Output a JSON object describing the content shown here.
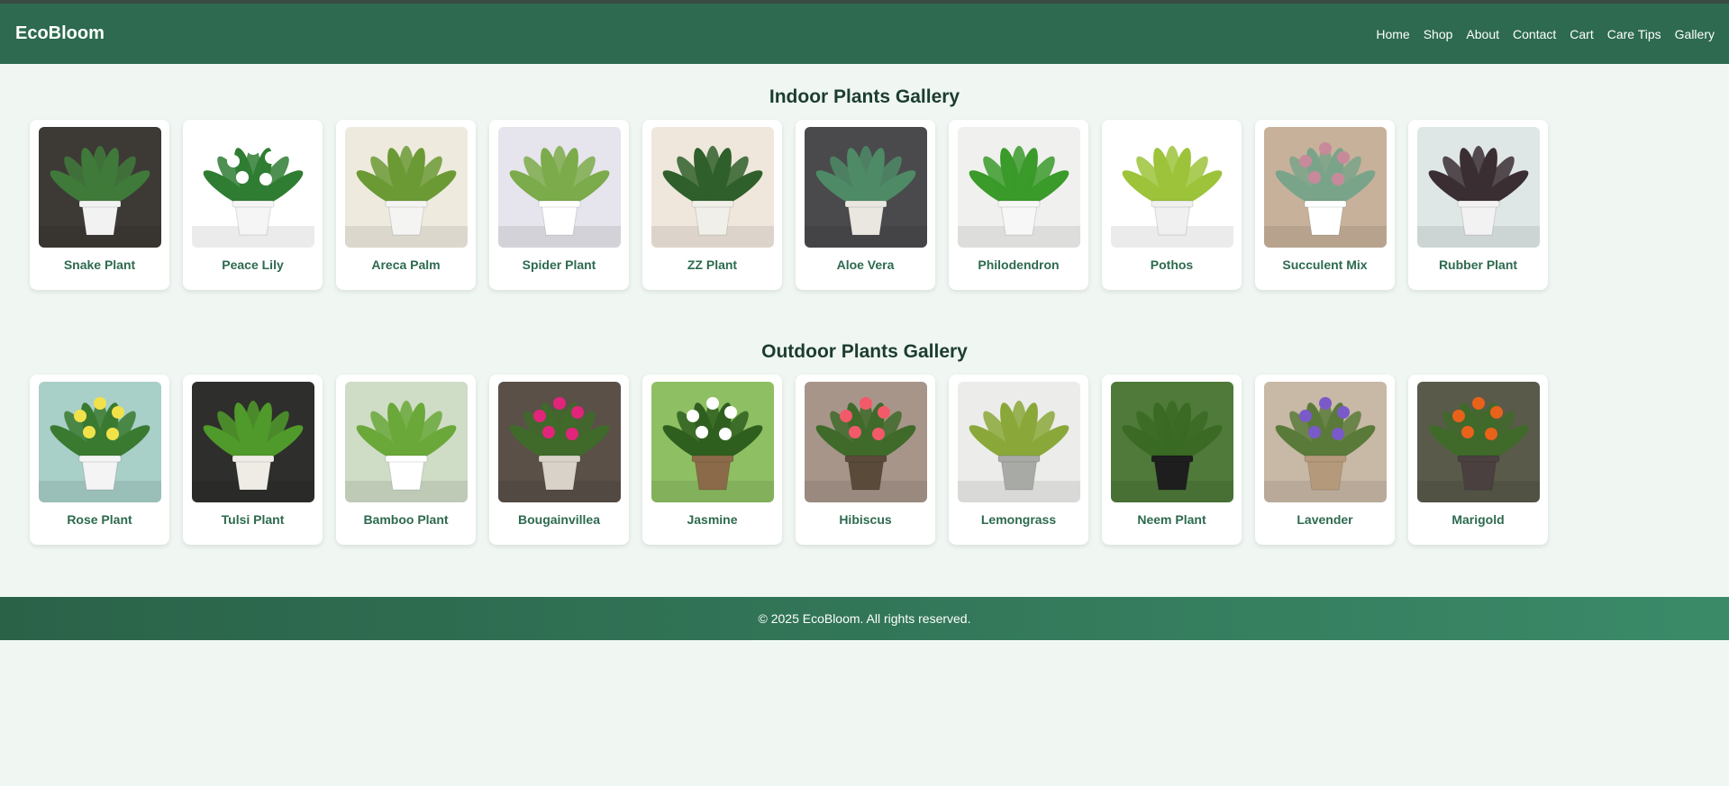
{
  "brand": "EcoBloom",
  "nav": [
    "Home",
    "Shop",
    "About",
    "Contact",
    "Cart",
    "Care Tips",
    "Gallery"
  ],
  "indoor": {
    "title": "Indoor Plants Gallery",
    "plants": [
      {
        "name": "Snake Plant",
        "bg": "#3d3a36",
        "pot": "#f2f2f2",
        "leaf": "#3f7a3a",
        "flower": ""
      },
      {
        "name": "Peace Lily",
        "bg": "#ffffff",
        "pot": "#f5f5f5",
        "leaf": "#2f7d32",
        "flower": "#ffffff"
      },
      {
        "name": "Areca Palm",
        "bg": "#eeeade",
        "pot": "#f4f4f2",
        "leaf": "#6b9a35",
        "flower": ""
      },
      {
        "name": "Spider Plant",
        "bg": "#e6e4ec",
        "pot": "#ffffff",
        "leaf": "#7bab4a",
        "flower": ""
      },
      {
        "name": "ZZ Plant",
        "bg": "#efe7dc",
        "pot": "#f1efe9",
        "leaf": "#2f5f2a",
        "flower": ""
      },
      {
        "name": "Aloe Vera",
        "bg": "#4a4a4c",
        "pot": "#e9e7e0",
        "leaf": "#4e8a66",
        "flower": ""
      },
      {
        "name": "Philodendron",
        "bg": "#f0f0ee",
        "pot": "#f7f7f7",
        "leaf": "#3a9a2a",
        "flower": ""
      },
      {
        "name": "Pothos",
        "bg": "#ffffff",
        "pot": "#f0f0f0",
        "leaf": "#9cc33a",
        "flower": ""
      },
      {
        "name": "Succulent Mix",
        "bg": "#c7b19a",
        "pot": "#ffffff",
        "leaf": "#7aa48a",
        "flower": "#c78a9a"
      },
      {
        "name": "Rubber Plant",
        "bg": "#dfe7e6",
        "pot": "#f2f2f2",
        "leaf": "#3a2e33",
        "flower": ""
      }
    ]
  },
  "outdoor": {
    "title": "Outdoor Plants Gallery",
    "plants": [
      {
        "name": "Rose Plant",
        "bg": "#a8cfc8",
        "pot": "#f4f4f4",
        "leaf": "#3a7a30",
        "flower": "#f2e24a"
      },
      {
        "name": "Tulsi Plant",
        "bg": "#2e2e2c",
        "pot": "#efece6",
        "leaf": "#4f9a2a",
        "flower": ""
      },
      {
        "name": "Bamboo Plant",
        "bg": "#cfdcc6",
        "pot": "#ffffff",
        "leaf": "#6aa83a",
        "flower": ""
      },
      {
        "name": "Bougainvillea",
        "bg": "#5a5048",
        "pot": "#d8d2c8",
        "leaf": "#3f6a2a",
        "flower": "#e0257a"
      },
      {
        "name": "Jasmine",
        "bg": "#8fbf63",
        "pot": "#8a6a48",
        "leaf": "#2f5f1f",
        "flower": "#ffffff"
      },
      {
        "name": "Hibiscus",
        "bg": "#a8958a",
        "pot": "#5a4a3a",
        "leaf": "#3f6a2a",
        "flower": "#f25a6a"
      },
      {
        "name": "Lemongrass",
        "bg": "#ececea",
        "pot": "#a8aaa6",
        "leaf": "#8aa83a",
        "flower": ""
      },
      {
        "name": "Neem Plant",
        "bg": "#4f7a3a",
        "pot": "#1e1e1e",
        "leaf": "#3a6a23",
        "flower": ""
      },
      {
        "name": "Lavender",
        "bg": "#c8b8a6",
        "pot": "#b49a7a",
        "leaf": "#5a7a3a",
        "flower": "#7a5ac8"
      },
      {
        "name": "Marigold",
        "bg": "#5a5a4a",
        "pot": "#4a4040",
        "leaf": "#3f6a2a",
        "flower": "#e8621a"
      }
    ]
  },
  "footer": "© 2025 EcoBloom. All rights reserved."
}
